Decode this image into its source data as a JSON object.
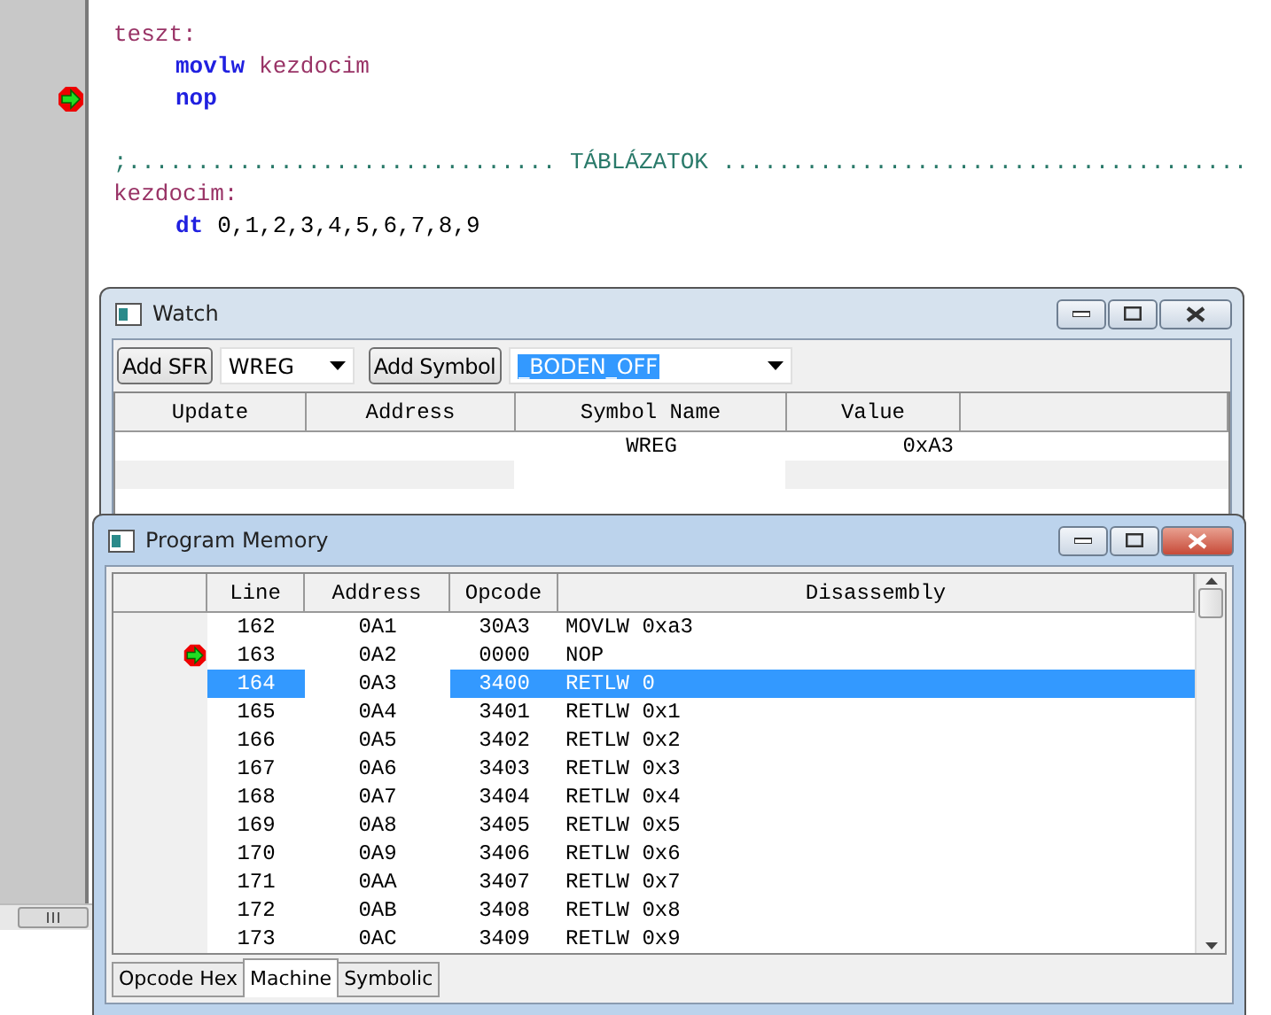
{
  "editor": {
    "lines": [
      {
        "current": false,
        "indented": false,
        "tokens": [
          {
            "kind": "label",
            "text": "teszt:"
          }
        ]
      },
      {
        "current": false,
        "indented": true,
        "tokens": [
          {
            "kind": "keyword",
            "text": "movlw"
          },
          {
            "kind": "symbol",
            "text": "kezdocim"
          }
        ]
      },
      {
        "current": true,
        "indented": true,
        "tokens": [
          {
            "kind": "keyword",
            "text": "nop"
          }
        ]
      },
      {
        "current": false
      },
      {
        "current": false,
        "indented": false,
        "tokens": [
          {
            "kind": "comment",
            "text": ";............................... TÁBLÁZATOK ......................................"
          }
        ]
      },
      {
        "current": false,
        "indented": false,
        "tokens": [
          {
            "kind": "label",
            "text": "kezdocim:"
          }
        ]
      },
      {
        "current": false,
        "indented": true,
        "tokens": [
          {
            "kind": "keyword",
            "text": "dt"
          },
          {
            "kind": "number",
            "text": "0,1,2,3,4,5,6,7,8,9"
          }
        ]
      }
    ]
  },
  "watch": {
    "title": "Watch",
    "active": false,
    "toolbar": {
      "sfr_button": "Add SFR",
      "sfr_select": "WREG",
      "symbol_button": "Add Symbol",
      "symbol_select": "_BODEN_OFF"
    },
    "columns": [
      "Update",
      "Address",
      "Symbol Name",
      "Value"
    ],
    "rows": [
      {
        "symbol_name": "WREG",
        "value": "0xA3"
      }
    ]
  },
  "program_memory": {
    "title": "Program Memory",
    "active": true,
    "columns": [
      "Line",
      "Address",
      "Opcode",
      "Disassembly"
    ],
    "rows": [
      {
        "line": "162",
        "address": "0A1",
        "opcode": "30A3",
        "disassembly": "MOVLW 0xa3",
        "current": false,
        "selected": false
      },
      {
        "line": "163",
        "address": "0A2",
        "opcode": "0000",
        "disassembly": "NOP",
        "current": true,
        "selected": false
      },
      {
        "line": "164",
        "address": "0A3",
        "opcode": "3400",
        "disassembly": "RETLW 0",
        "current": false,
        "selected": true
      },
      {
        "line": "165",
        "address": "0A4",
        "opcode": "3401",
        "disassembly": "RETLW 0x1",
        "current": false,
        "selected": false
      },
      {
        "line": "166",
        "address": "0A5",
        "opcode": "3402",
        "disassembly": "RETLW 0x2",
        "current": false,
        "selected": false
      },
      {
        "line": "167",
        "address": "0A6",
        "opcode": "3403",
        "disassembly": "RETLW 0x3",
        "current": false,
        "selected": false
      },
      {
        "line": "168",
        "address": "0A7",
        "opcode": "3404",
        "disassembly": "RETLW 0x4",
        "current": false,
        "selected": false
      },
      {
        "line": "169",
        "address": "0A8",
        "opcode": "3405",
        "disassembly": "RETLW 0x5",
        "current": false,
        "selected": false
      },
      {
        "line": "170",
        "address": "0A9",
        "opcode": "3406",
        "disassembly": "RETLW 0x6",
        "current": false,
        "selected": false
      },
      {
        "line": "171",
        "address": "0AA",
        "opcode": "3407",
        "disassembly": "RETLW 0x7",
        "current": false,
        "selected": false
      },
      {
        "line": "172",
        "address": "0AB",
        "opcode": "3408",
        "disassembly": "RETLW 0x8",
        "current": false,
        "selected": false
      },
      {
        "line": "173",
        "address": "0AC",
        "opcode": "3409",
        "disassembly": "RETLW 0x9",
        "current": false,
        "selected": false
      }
    ],
    "tabs": [
      {
        "label": "Opcode Hex",
        "selected": false
      },
      {
        "label": "Machine",
        "selected": true
      },
      {
        "label": "Symbolic",
        "selected": false
      }
    ]
  }
}
